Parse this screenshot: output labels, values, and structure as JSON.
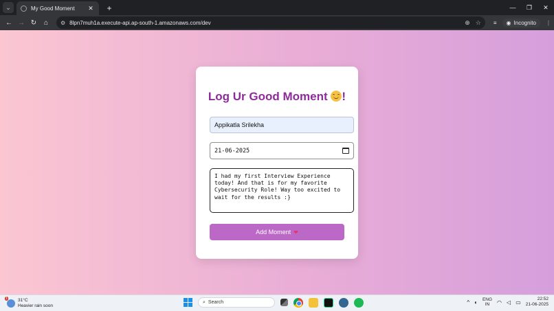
{
  "browser": {
    "tab_title": "My Good Moment",
    "url": "8lpn7muh1a.execute-api.ap-south-1.amazonaws.com/dev",
    "incognito_label": "Incognito"
  },
  "form": {
    "title": "Log Ur Good Moment",
    "title_suffix": "!",
    "name_value": "Appikatla Srilekha",
    "date_value": "21-06-2025",
    "moment_value": "I had my first Interview Experience today! And that is for my favorite Cybersecurity Role! Way too excited to wait for the results :}",
    "button_label": "Add Moment"
  },
  "taskbar": {
    "weather_badge": "1",
    "temperature": "31°C",
    "weather_desc": "Heavier rain soon",
    "search_placeholder": "Search",
    "lang_line1": "ENG",
    "lang_line2": "IN",
    "time": "22:52",
    "date": "21-06-2025"
  },
  "colors": {
    "title": "#8e2a9a",
    "button": "#bc68c7",
    "gradient_start": "#fbc6d2",
    "gradient_end": "#d69fdc"
  }
}
